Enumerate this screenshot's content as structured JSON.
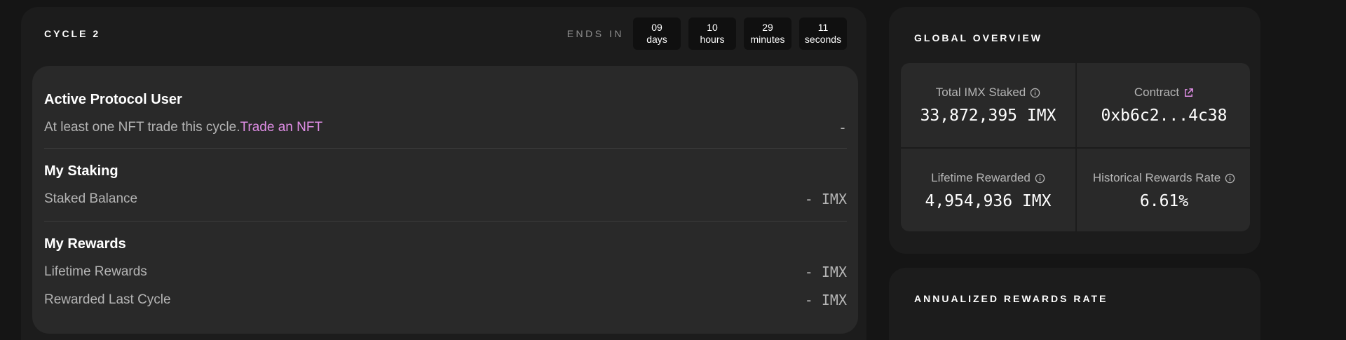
{
  "cycle": {
    "title": "CYCLE 2",
    "ends_in_label": "ENDS IN",
    "countdown": [
      {
        "value": "09",
        "unit": "days"
      },
      {
        "value": "10",
        "unit": "hours"
      },
      {
        "value": "29",
        "unit": "minutes"
      },
      {
        "value": "11",
        "unit": "seconds"
      }
    ]
  },
  "active_user": {
    "title": "Active Protocol User",
    "description": "At least one NFT trade this cycle.",
    "link_label": "Trade an NFT",
    "status": "-"
  },
  "staking": {
    "title": "My Staking",
    "balance_label": "Staked Balance",
    "balance_value": "- IMX"
  },
  "rewards": {
    "title": "My Rewards",
    "lifetime_label": "Lifetime Rewards",
    "lifetime_value": "- IMX",
    "last_cycle_label": "Rewarded Last Cycle",
    "last_cycle_value": "- IMX"
  },
  "global": {
    "title": "GLOBAL OVERVIEW",
    "total_staked_label": "Total IMX Staked",
    "total_staked_value": "33,872,395 IMX",
    "contract_label": "Contract",
    "contract_value": "0xb6c2...4c38",
    "lifetime_rewarded_label": "Lifetime Rewarded",
    "lifetime_rewarded_value": "4,954,936 IMX",
    "historical_rate_label": "Historical Rewards Rate",
    "historical_rate_value": "6.61%"
  },
  "annualized": {
    "title": "ANNUALIZED REWARDS RATE"
  },
  "colors": {
    "accent_link": "#e08ee6",
    "background": "#151515",
    "panel": "#1c1c1c",
    "card": "#292929"
  },
  "icons": {
    "info": "info-icon",
    "external_link": "external-link-icon"
  }
}
